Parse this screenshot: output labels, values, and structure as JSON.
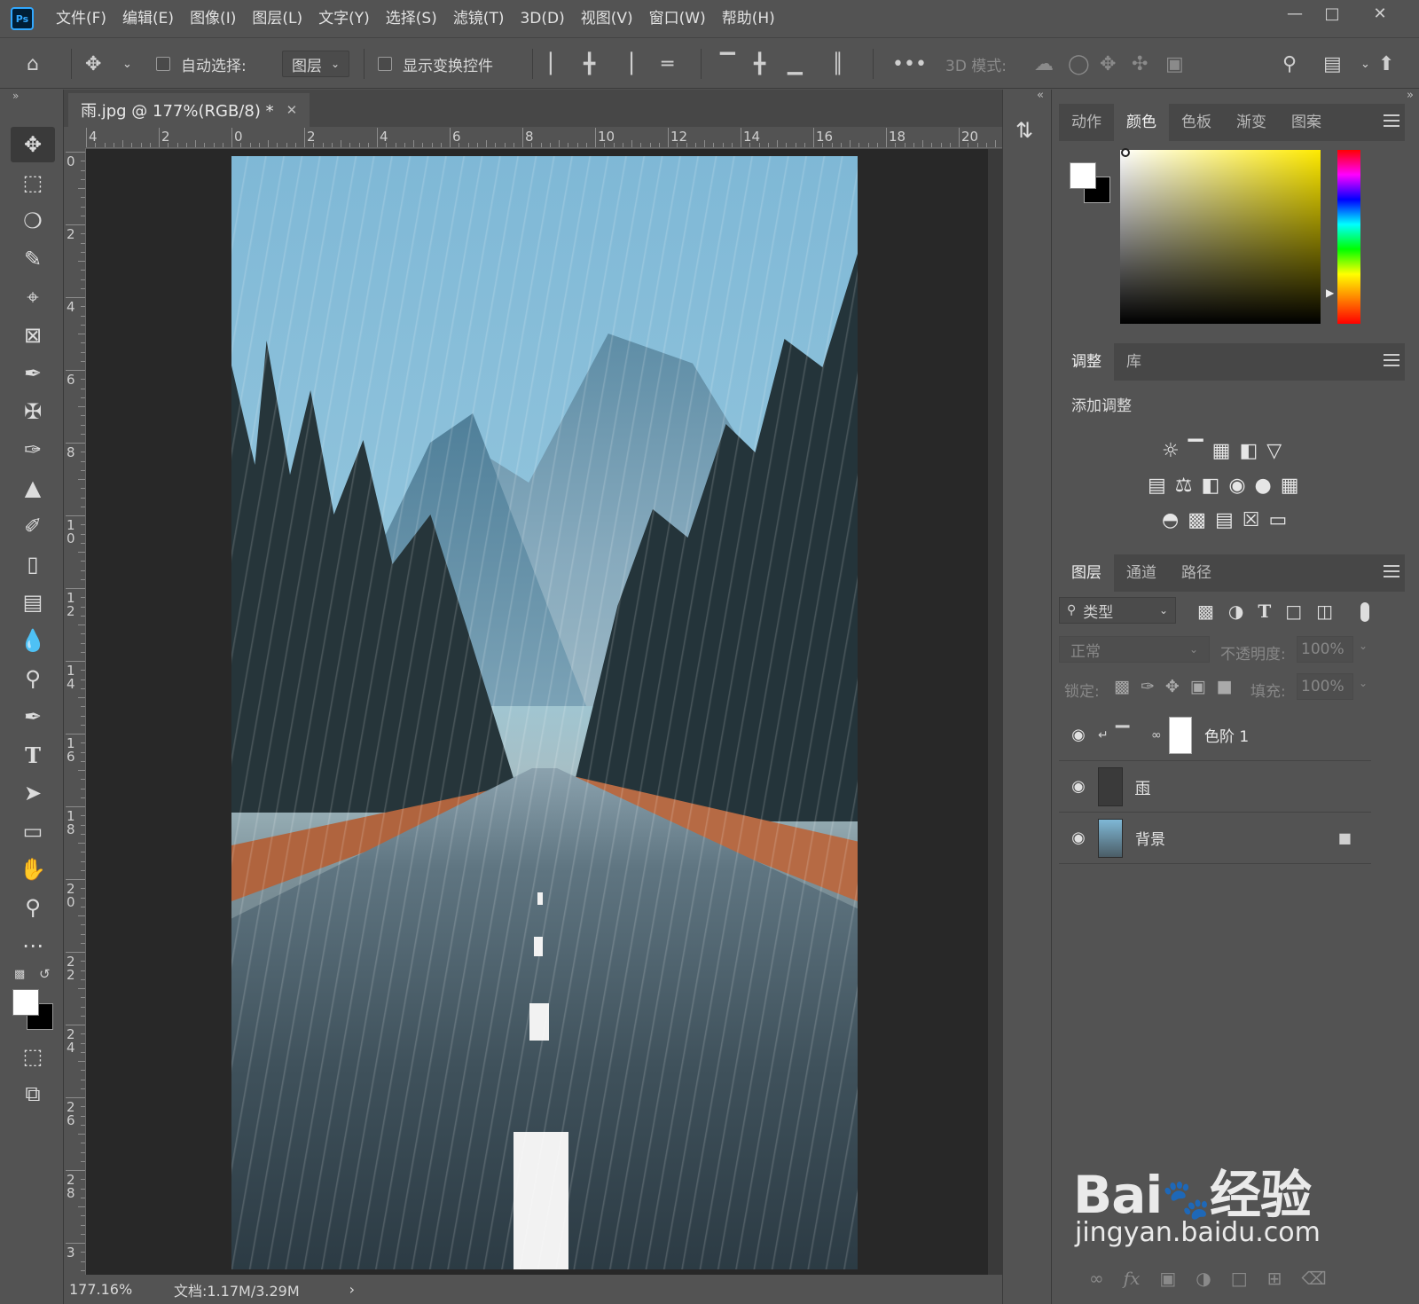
{
  "app": {
    "logo": "Ps"
  },
  "menu": [
    "文件(F)",
    "编辑(E)",
    "图像(I)",
    "图层(L)",
    "文字(Y)",
    "选择(S)",
    "滤镜(T)",
    "3D(D)",
    "视图(V)",
    "窗口(W)",
    "帮助(H)"
  ],
  "options": {
    "auto_select_label": "自动选择:",
    "auto_select_target": "图层",
    "show_transform_label": "显示变换控件",
    "mode_3d_label": "3D 模式:"
  },
  "document": {
    "tab_title": "雨.jpg @ 177%(RGB/8) *",
    "ruler_h_labels": [
      "4",
      "2",
      "0",
      "2",
      "4",
      "6",
      "8",
      "10",
      "12",
      "14",
      "16",
      "18",
      "20"
    ],
    "ruler_v_labels": [
      "0",
      "2",
      "4",
      "6",
      "8",
      "1\n0",
      "1\n2",
      "1\n4",
      "1\n6",
      "1\n8",
      "2\n0",
      "2\n2",
      "2\n4",
      "2\n6",
      "2\n8",
      "3"
    ],
    "zoom": "177.16%",
    "doc_info": "文档:1.17M/3.29M"
  },
  "panels": {
    "color_tabs": [
      "动作",
      "颜色",
      "色板",
      "渐变",
      "图案"
    ],
    "color_active_tab": "颜色",
    "adjust_tabs": [
      "调整",
      "库"
    ],
    "adjust_title": "添加调整",
    "layers_tabs": [
      "图层",
      "通道",
      "路径"
    ],
    "filter_type": "类型",
    "blend_mode": "正常",
    "opacity_label": "不透明度:",
    "opacity_value": "100%",
    "lock_label": "锁定:",
    "fill_label": "填充:",
    "fill_value": "100%",
    "layers": [
      {
        "name": "色阶 1",
        "kind": "adjustment",
        "visible": true
      },
      {
        "name": "雨",
        "kind": "pixel",
        "visible": true
      },
      {
        "name": "背景",
        "kind": "background",
        "visible": true,
        "locked": true
      }
    ]
  },
  "watermark": {
    "logo": "Bai du 经验",
    "url": "jingyan.baidu.com"
  },
  "colors": {
    "ui_bg": "#535353",
    "canvas_bg": "#282828",
    "accent": "#31a8ff"
  }
}
